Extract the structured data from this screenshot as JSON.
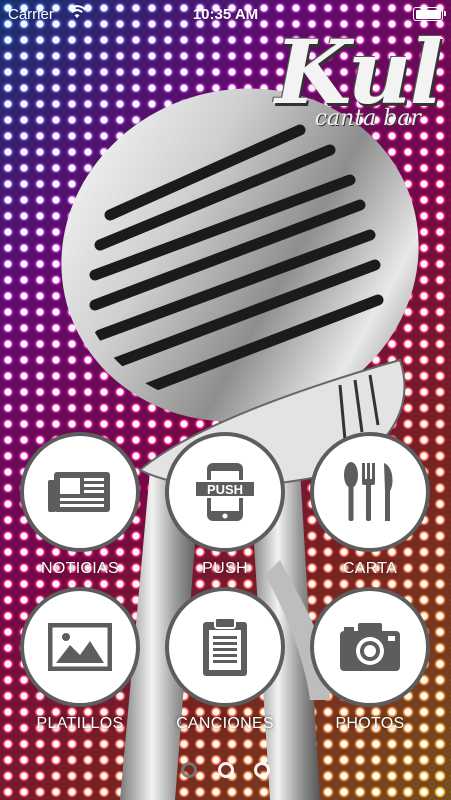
{
  "status_bar": {
    "carrier": "Carrier",
    "time": "10:35 AM",
    "battery_level": 1.0
  },
  "logo": {
    "brand": "Kul",
    "subtitle": "canta bar"
  },
  "menu": [
    {
      "label": "NOTICIAS",
      "icon": "newspaper-icon"
    },
    {
      "label": "PUSH",
      "icon": "push-phone-icon",
      "icon_text": "PUSH"
    },
    {
      "label": "CARTA",
      "icon": "cutlery-icon"
    },
    {
      "label": "PLATILLOS",
      "icon": "image-icon"
    },
    {
      "label": "CANCIONES",
      "icon": "clipboard-list-icon"
    },
    {
      "label": "PHOTOS",
      "icon": "camera-icon"
    }
  ],
  "pager": {
    "pages": 3,
    "current": 1
  },
  "colors": {
    "icon_gray": "#5d5d5d",
    "circle_fill": "#ffffff",
    "label": "#ffffff"
  }
}
